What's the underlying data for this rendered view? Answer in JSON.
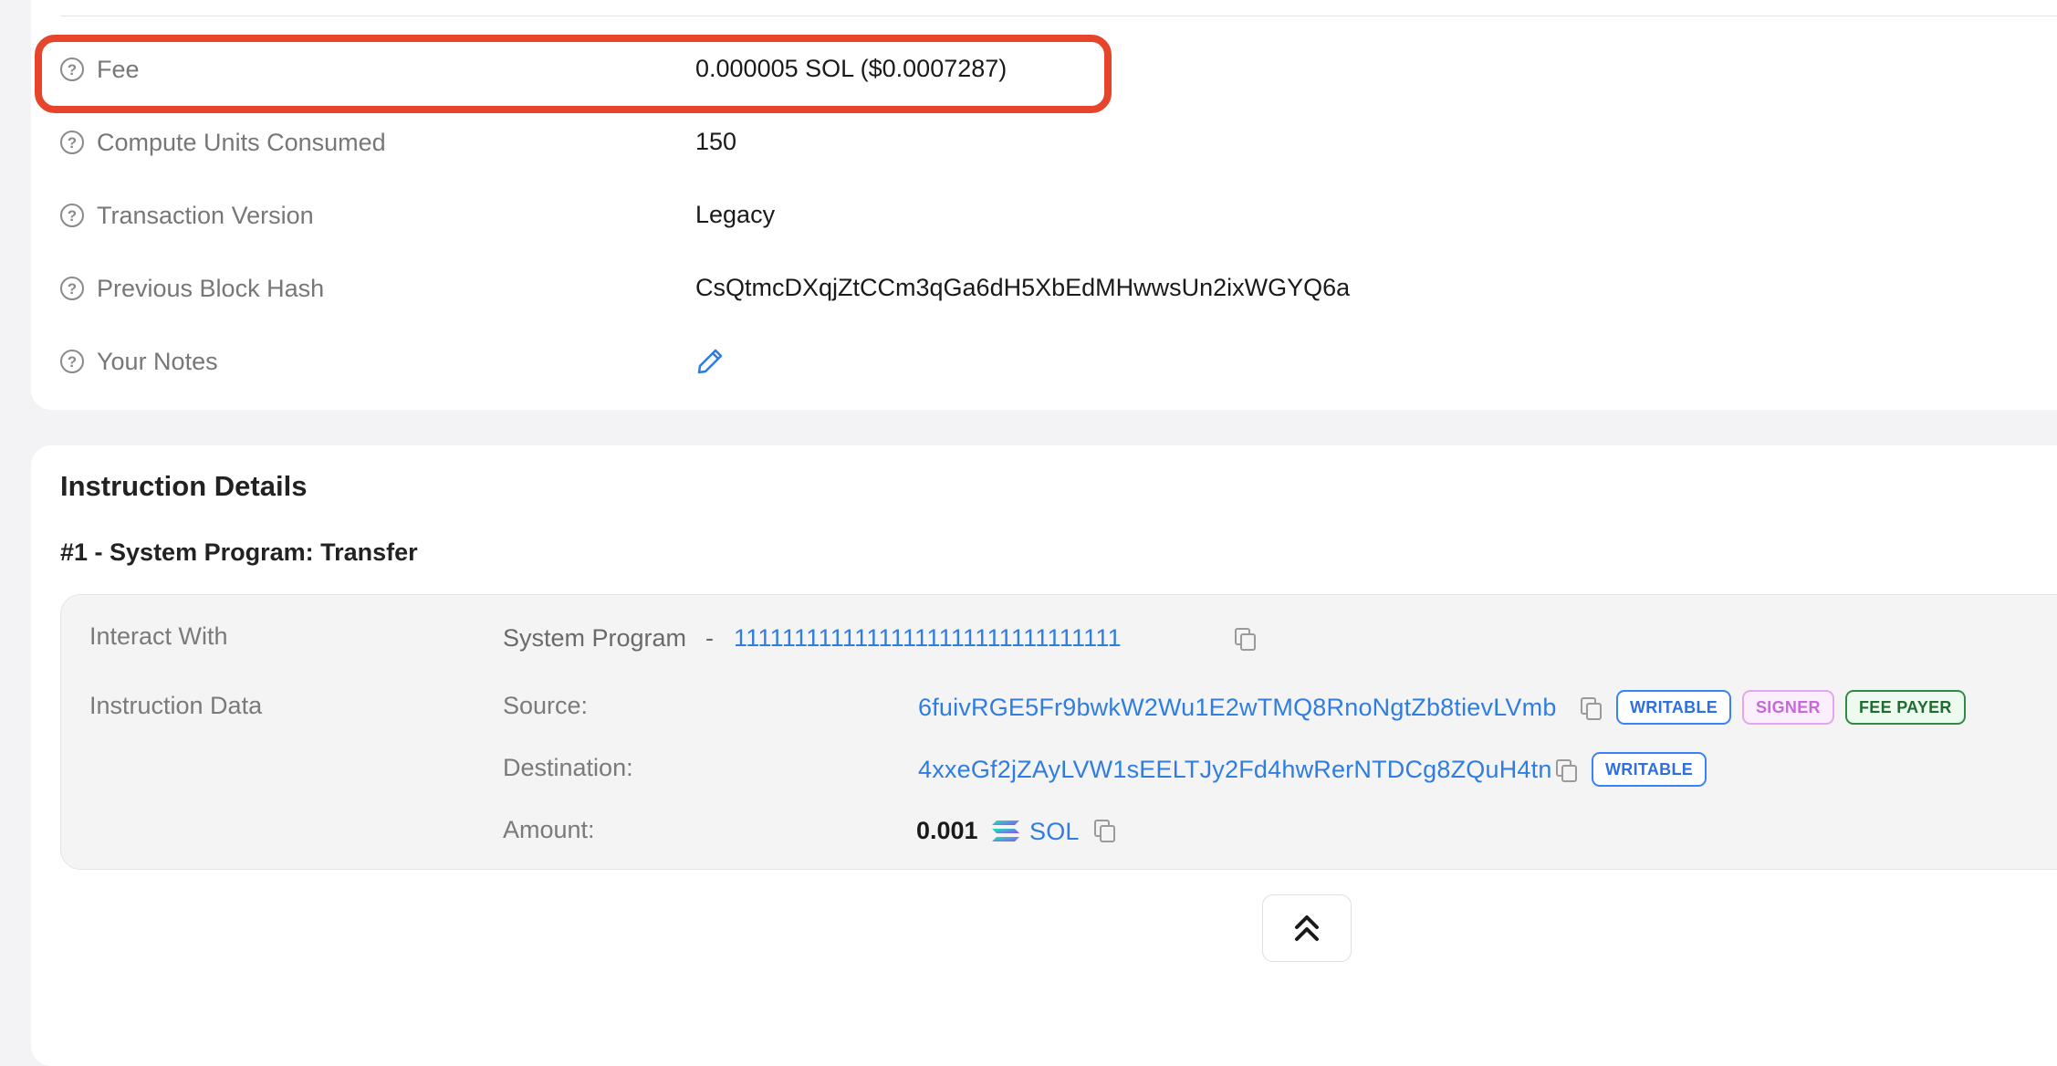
{
  "details": {
    "rows": [
      {
        "label": "Fee",
        "value": "0.000005 SOL ($0.0007287)"
      },
      {
        "label": "Compute Units Consumed",
        "value": "150"
      },
      {
        "label": "Transaction Version",
        "value": "Legacy"
      },
      {
        "label": "Previous Block Hash",
        "value": "CsQtmcDXqjZtCCm3qGa6dH5XbEdMHwwsUn2ixWGYQ6a"
      },
      {
        "label": "Your Notes",
        "value": ""
      }
    ]
  },
  "instruction_details": {
    "title": "Instruction Details",
    "instruction": {
      "title": "#1 - System Program: Transfer",
      "interact_with_label": "Interact With",
      "program_name": "System Program",
      "separator": "-",
      "program_address": "11111111111111111111111111111111",
      "instruction_data_label": "Instruction Data",
      "source_label": "Source:",
      "source_address": "6fuivRGE5Fr9bwkW2Wu1E2wTMQ8RnoNgtZb8tievLVmb",
      "source_badges": [
        "WRITABLE",
        "SIGNER",
        "FEE PAYER"
      ],
      "destination_label": "Destination:",
      "destination_address": "4xxeGf2jZAyLVW1sEELTJy2Fd4hwRerNTDCg8ZQuH4tn",
      "destination_badges": [
        "WRITABLE"
      ],
      "amount_label": "Amount:",
      "amount_value": "0.001",
      "amount_token": "SOL"
    }
  },
  "icons": {
    "help": "help-circle-icon",
    "edit": "pencil-icon",
    "copy": "copy-icon",
    "token": "solana-logo-icon",
    "scroll_top": "double-chevron-up-icon"
  },
  "colors": {
    "highlight": "#e6452c",
    "link": "#2f7de1",
    "writable": "#2f6fde",
    "signer": "#c66ad9",
    "fee_payer": "#206b33"
  }
}
